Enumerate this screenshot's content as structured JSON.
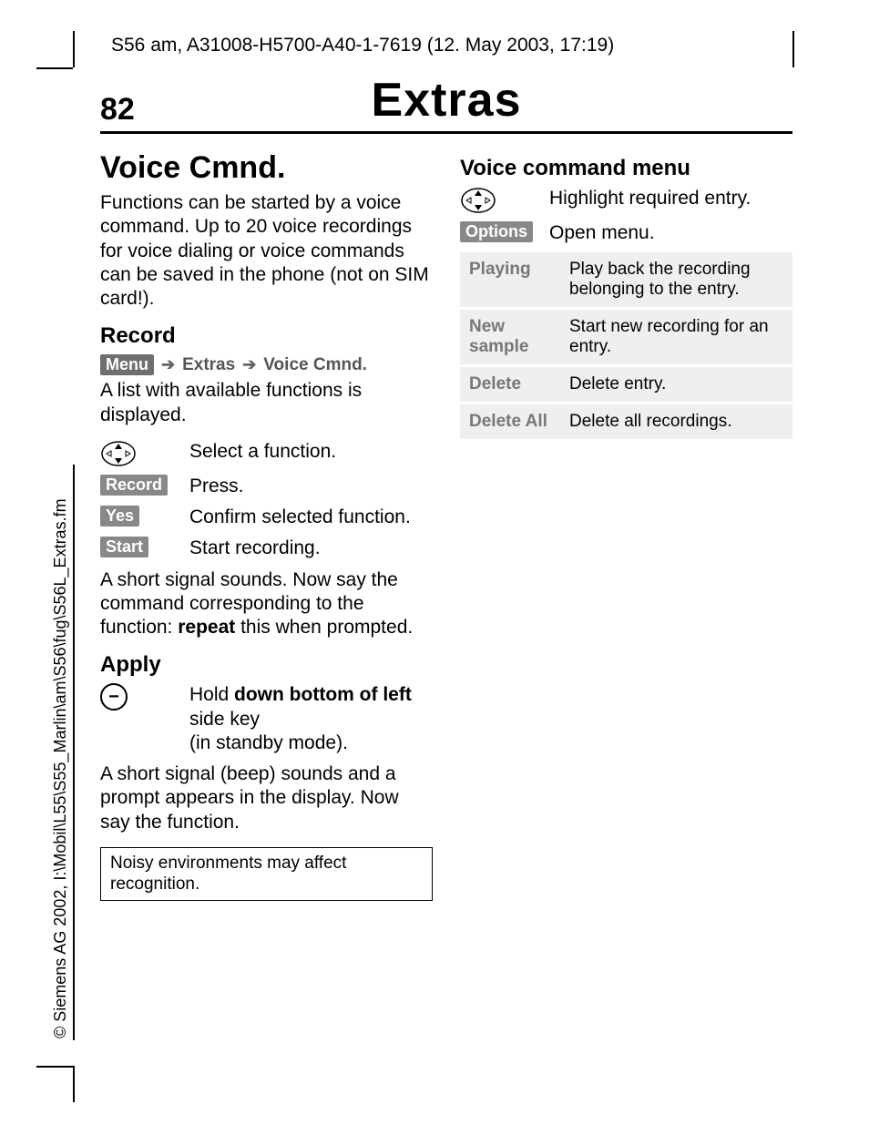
{
  "header": "S56 am, A31008-H5700-A40-1-7619 (12. May 2003, 17:19)",
  "page_num": "82",
  "page_title": "Extras",
  "copyright": "© Siemens AG 2002, I:\\Mobil\\L55\\S55_Marlin\\am\\S56\\fug\\S56L_Extras.fm",
  "left": {
    "h1": "Voice Cmnd.",
    "intro": "Functions can be started by a voice command. Up to 20 voice recordings for voice dialing or voice commands can be saved in the phone (not on SIM card!).",
    "record": {
      "heading": "Record",
      "nav": {
        "menu": "Menu",
        "extras": "Extras",
        "voice": "Voice Cmnd."
      },
      "line1": "A list with available functions is displayed.",
      "select_fn": "Select a function.",
      "record_key": "Record",
      "record_text": "Press.",
      "yes_key": "Yes",
      "yes_text": "Confirm selected function.",
      "start_key": "Start",
      "start_text": "Start recording.",
      "outro_pre": "A short signal sounds. Now say the command corresponding to the function: ",
      "outro_bold": "repeat",
      "outro_post": " this when prompted."
    },
    "apply": {
      "heading": "Apply",
      "hold_pre": "Hold ",
      "hold_b1": "down bottom of left",
      "hold_mid": " side key",
      "hold_post": "(in standby mode).",
      "outro": "A short signal (beep) sounds and a prompt appears in the display. Now say the function.",
      "note": "Noisy environments may affect recognition."
    }
  },
  "right": {
    "heading": "Voice command menu",
    "highlight": "Highlight required entry.",
    "options_key": "Options",
    "options_text": "Open menu.",
    "table": [
      {
        "label": "Playing",
        "desc": "Play back the recording belonging to the entry."
      },
      {
        "label": "New sample",
        "desc": "Start new recording for an entry."
      },
      {
        "label": "Delete",
        "desc": "Delete entry."
      },
      {
        "label": "Delete All",
        "desc": "Delete all recordings."
      }
    ]
  }
}
